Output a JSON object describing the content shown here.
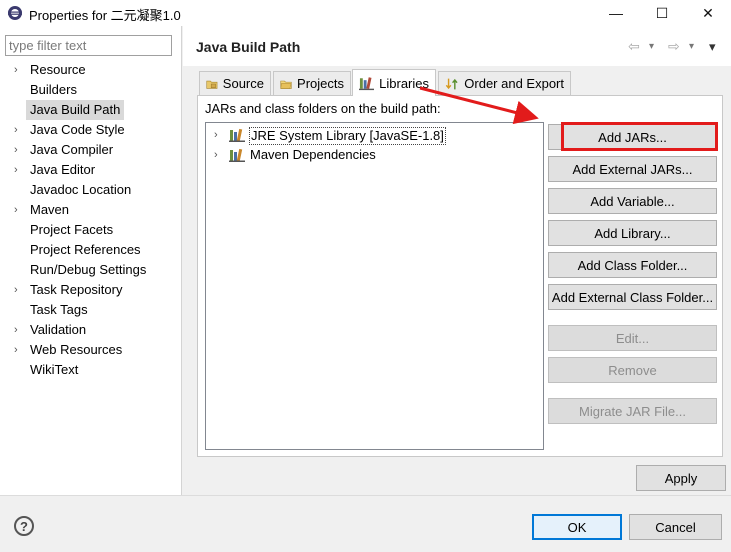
{
  "window": {
    "title": "Properties for 二元凝聚1.0",
    "minimize_glyph": "—",
    "maximize_glyph": "☐",
    "close_glyph": "✕"
  },
  "sidebar": {
    "filter_placeholder": "type filter text",
    "items": [
      {
        "label": "Resource",
        "expandable": true
      },
      {
        "label": "Builders",
        "expandable": false
      },
      {
        "label": "Java Build Path",
        "expandable": false,
        "selected": true
      },
      {
        "label": "Java Code Style",
        "expandable": true
      },
      {
        "label": "Java Compiler",
        "expandable": true
      },
      {
        "label": "Java Editor",
        "expandable": true
      },
      {
        "label": "Javadoc Location",
        "expandable": false
      },
      {
        "label": "Maven",
        "expandable": true
      },
      {
        "label": "Project Facets",
        "expandable": false
      },
      {
        "label": "Project References",
        "expandable": false
      },
      {
        "label": "Run/Debug Settings",
        "expandable": false
      },
      {
        "label": "Task Repository",
        "expandable": true
      },
      {
        "label": "Task Tags",
        "expandable": false
      },
      {
        "label": "Validation",
        "expandable": true
      },
      {
        "label": "Web Resources",
        "expandable": true
      },
      {
        "label": "WikiText",
        "expandable": false
      }
    ]
  },
  "header": {
    "title": "Java Build Path",
    "back_glyph": "⇦",
    "forward_glyph": "⇨",
    "dropdown_glyph": "▾",
    "menu_glyph": "▾"
  },
  "tabs": [
    {
      "label": "Source",
      "icon": "source-folder-icon"
    },
    {
      "label": "Projects",
      "icon": "projects-folder-icon"
    },
    {
      "label": "Libraries",
      "icon": "libraries-icon",
      "active": true
    },
    {
      "label": "Order and Export",
      "icon": "order-export-icon"
    }
  ],
  "libraries": {
    "caption": "JARs and class folders on the build path:",
    "entries": [
      {
        "label": "JRE System Library [JavaSE-1.8]"
      },
      {
        "label": "Maven Dependencies"
      }
    ],
    "buttons": [
      {
        "label": "Add JARs...",
        "disabled": false
      },
      {
        "label": "Add External JARs...",
        "disabled": false
      },
      {
        "label": "Add Variable...",
        "disabled": false
      },
      {
        "label": "Add Library...",
        "disabled": false
      },
      {
        "label": "Add Class Folder...",
        "disabled": false
      },
      {
        "label": "Add External Class Folder...",
        "disabled": false
      },
      {
        "label": "Edit...",
        "disabled": true
      },
      {
        "label": "Remove",
        "disabled": true
      },
      {
        "label": "Migrate JAR File...",
        "disabled": true
      }
    ]
  },
  "footer": {
    "apply_label": "Apply",
    "ok_label": "OK",
    "cancel_label": "Cancel",
    "help_glyph": "?"
  },
  "colors": {
    "annotation_red": "#e21b1b",
    "ok_border": "#0078d7"
  }
}
